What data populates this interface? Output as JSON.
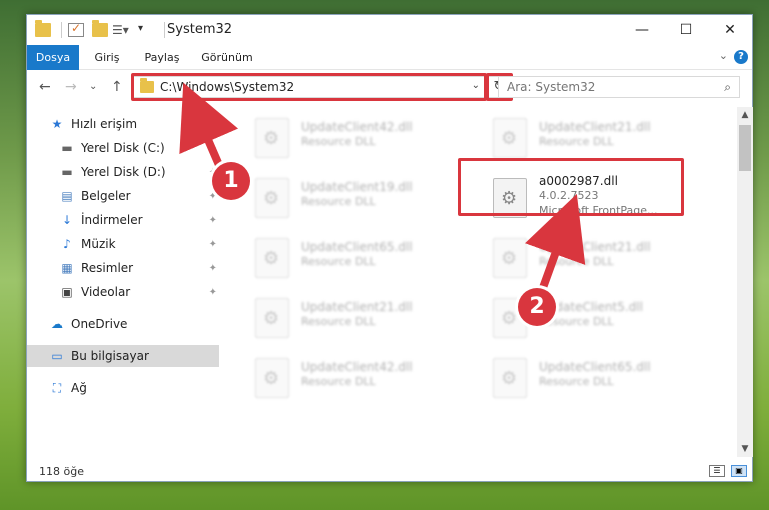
{
  "window": {
    "title": "System32",
    "minimize": "—",
    "maximize": "☐",
    "close": "✕"
  },
  "ribbon": {
    "tabs": [
      {
        "label": "Dosya",
        "active": true
      },
      {
        "label": "Giriş",
        "active": false
      },
      {
        "label": "Paylaş",
        "active": false
      },
      {
        "label": "Görünüm",
        "active": false
      }
    ],
    "expand": "⌄",
    "help": "?"
  },
  "nav": {
    "back": "←",
    "forward": "→",
    "recent": "⌄",
    "up": "↑",
    "address": "C:\\Windows\\System32",
    "address_chevron": "⌄",
    "refresh": "↻",
    "search_placeholder": "Ara: System32",
    "search_icon": "⌕"
  },
  "sidebar": {
    "items": [
      {
        "label": "Hızlı erişim",
        "icon": "star-icon",
        "glyph": "★",
        "color": "#2b78d6",
        "pinned": false
      },
      {
        "label": "Yerel Disk (C:)",
        "icon": "drive-icon",
        "glyph": "▬",
        "color": "#666666",
        "pinned": true
      },
      {
        "label": "Yerel Disk (D:)",
        "icon": "drive-icon",
        "glyph": "▬",
        "color": "#666666",
        "pinned": true
      },
      {
        "label": "Belgeler",
        "icon": "documents-icon",
        "glyph": "▤",
        "color": "#4a7fbf",
        "pinned": true
      },
      {
        "label": "İndirmeler",
        "icon": "download-icon",
        "glyph": "↓",
        "color": "#2b78d6",
        "pinned": true
      },
      {
        "label": "Müzik",
        "icon": "music-icon",
        "glyph": "♪",
        "color": "#2b78d6",
        "pinned": true
      },
      {
        "label": "Resimler",
        "icon": "pictures-icon",
        "glyph": "▦",
        "color": "#4a7fbf",
        "pinned": true
      },
      {
        "label": "Videolar",
        "icon": "video-icon",
        "glyph": "▣",
        "color": "#444444",
        "pinned": true
      },
      {
        "label": "OneDrive",
        "icon": "cloud-icon",
        "glyph": "☁",
        "color": "#1979ca",
        "pinned": false
      },
      {
        "label": "Bu bilgisayar",
        "icon": "computer-icon",
        "glyph": "▭",
        "color": "#2b78d6",
        "pinned": false
      },
      {
        "label": "Ağ",
        "icon": "network-icon",
        "glyph": "⛶",
        "color": "#2b78d6",
        "pinned": false
      }
    ],
    "pin_glyph": "📌"
  },
  "files": [
    {
      "name": "UpdateClient42.dll",
      "sub": "Resource DLL",
      "blur": true
    },
    {
      "name": "UpdateClient21.dll",
      "sub": "Resource DLL",
      "blur": true
    },
    {
      "name": "UpdateClient19.dll",
      "sub": "Resource DLL",
      "blur": true
    },
    {
      "name": "a0002987.dll",
      "sub": "4.0.2.7523",
      "sub2": "Microsoft FrontPage...",
      "blur": false
    },
    {
      "name": "UpdateClient65.dll",
      "sub": "Resource DLL",
      "blur": true
    },
    {
      "name": "UpdateClient21.dll",
      "sub": "Resource DLL",
      "blur": true
    },
    {
      "name": "UpdateClient21.dll",
      "sub": "Resource DLL",
      "blur": true
    },
    {
      "name": "UpdateClient5.dll",
      "sub": "Resource DLL",
      "blur": true
    },
    {
      "name": "UpdateClient42.dll",
      "sub": "Resource DLL",
      "blur": true
    },
    {
      "name": "UpdateClient65.dll",
      "sub": "Resource DLL",
      "blur": true
    }
  ],
  "status": {
    "count": "118 öğe"
  },
  "annotations": {
    "step1": "1",
    "step2": "2",
    "color": "#d9363e"
  }
}
